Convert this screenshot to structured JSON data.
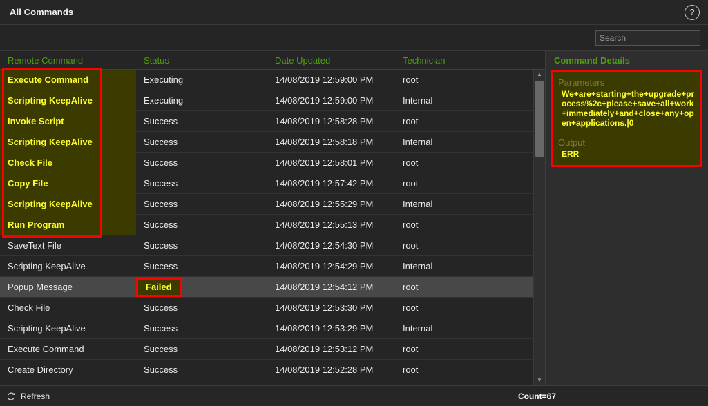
{
  "window": {
    "title": "All Commands",
    "help_icon": "question-mark-circle-icon"
  },
  "search": {
    "placeholder": "Search",
    "value": ""
  },
  "table": {
    "columns": [
      "Remote Command",
      "Status",
      "Date Updated",
      "Technician"
    ],
    "rows": [
      {
        "command": "Execute Command",
        "status": "Executing",
        "date": "14/08/2019 12:59:00 PM",
        "technician": "root",
        "command_highlight": true,
        "status_highlight": false,
        "selected": false
      },
      {
        "command": "Scripting KeepAlive",
        "status": "Executing",
        "date": "14/08/2019 12:59:00 PM",
        "technician": "Internal",
        "command_highlight": true,
        "status_highlight": false,
        "selected": false
      },
      {
        "command": "Invoke Script",
        "status": "Success",
        "date": "14/08/2019 12:58:28 PM",
        "technician": "root",
        "command_highlight": true,
        "status_highlight": false,
        "selected": false
      },
      {
        "command": "Scripting KeepAlive",
        "status": "Success",
        "date": "14/08/2019 12:58:18 PM",
        "technician": "Internal",
        "command_highlight": true,
        "status_highlight": false,
        "selected": false
      },
      {
        "command": "Check File",
        "status": "Success",
        "date": "14/08/2019 12:58:01 PM",
        "technician": "root",
        "command_highlight": true,
        "status_highlight": false,
        "selected": false
      },
      {
        "command": "Copy File",
        "status": "Success",
        "date": "14/08/2019 12:57:42 PM",
        "technician": "root",
        "command_highlight": true,
        "status_highlight": false,
        "selected": false
      },
      {
        "command": "Scripting KeepAlive",
        "status": "Success",
        "date": "14/08/2019 12:55:29 PM",
        "technician": "Internal",
        "command_highlight": true,
        "status_highlight": false,
        "selected": false
      },
      {
        "command": "Run Program",
        "status": "Success",
        "date": "14/08/2019 12:55:13 PM",
        "technician": "root",
        "command_highlight": true,
        "status_highlight": false,
        "selected": false
      },
      {
        "command": "SaveText File",
        "status": "Success",
        "date": "14/08/2019 12:54:30 PM",
        "technician": "root",
        "command_highlight": false,
        "status_highlight": false,
        "selected": false
      },
      {
        "command": "Scripting KeepAlive",
        "status": "Success",
        "date": "14/08/2019 12:54:29 PM",
        "technician": "Internal",
        "command_highlight": false,
        "status_highlight": false,
        "selected": false
      },
      {
        "command": "Popup Message",
        "status": "Failed",
        "date": "14/08/2019 12:54:12 PM",
        "technician": "root",
        "command_highlight": false,
        "status_highlight": true,
        "selected": true
      },
      {
        "command": "Check File",
        "status": "Success",
        "date": "14/08/2019 12:53:30 PM",
        "technician": "root",
        "command_highlight": false,
        "status_highlight": false,
        "selected": false
      },
      {
        "command": "Scripting KeepAlive",
        "status": "Success",
        "date": "14/08/2019 12:53:29 PM",
        "technician": "Internal",
        "command_highlight": false,
        "status_highlight": false,
        "selected": false
      },
      {
        "command": "Execute Command",
        "status": "Success",
        "date": "14/08/2019 12:53:12 PM",
        "technician": "root",
        "command_highlight": false,
        "status_highlight": false,
        "selected": false
      },
      {
        "command": "Create Directory",
        "status": "Success",
        "date": "14/08/2019 12:52:28 PM",
        "technician": "root",
        "command_highlight": false,
        "status_highlight": false,
        "selected": false
      }
    ]
  },
  "details": {
    "title": "Command Details",
    "parameters_label": "Parameters",
    "parameters_value": "We+are+starting+the+upgrade+process%2c+please+save+all+work+immediately+and+close+any+open+applications.|0",
    "output_label": "Output",
    "output_value": "ERR"
  },
  "footer": {
    "refresh_label": "Refresh",
    "refresh_icon": "refresh-icon",
    "count_label": "Count=67"
  },
  "colors": {
    "header_green": "#4f9e10",
    "highlight_bg": "#3b3b00",
    "highlight_text": "#ffff2a",
    "annotation_red": "#fe0000",
    "selected_row": "#484848"
  }
}
